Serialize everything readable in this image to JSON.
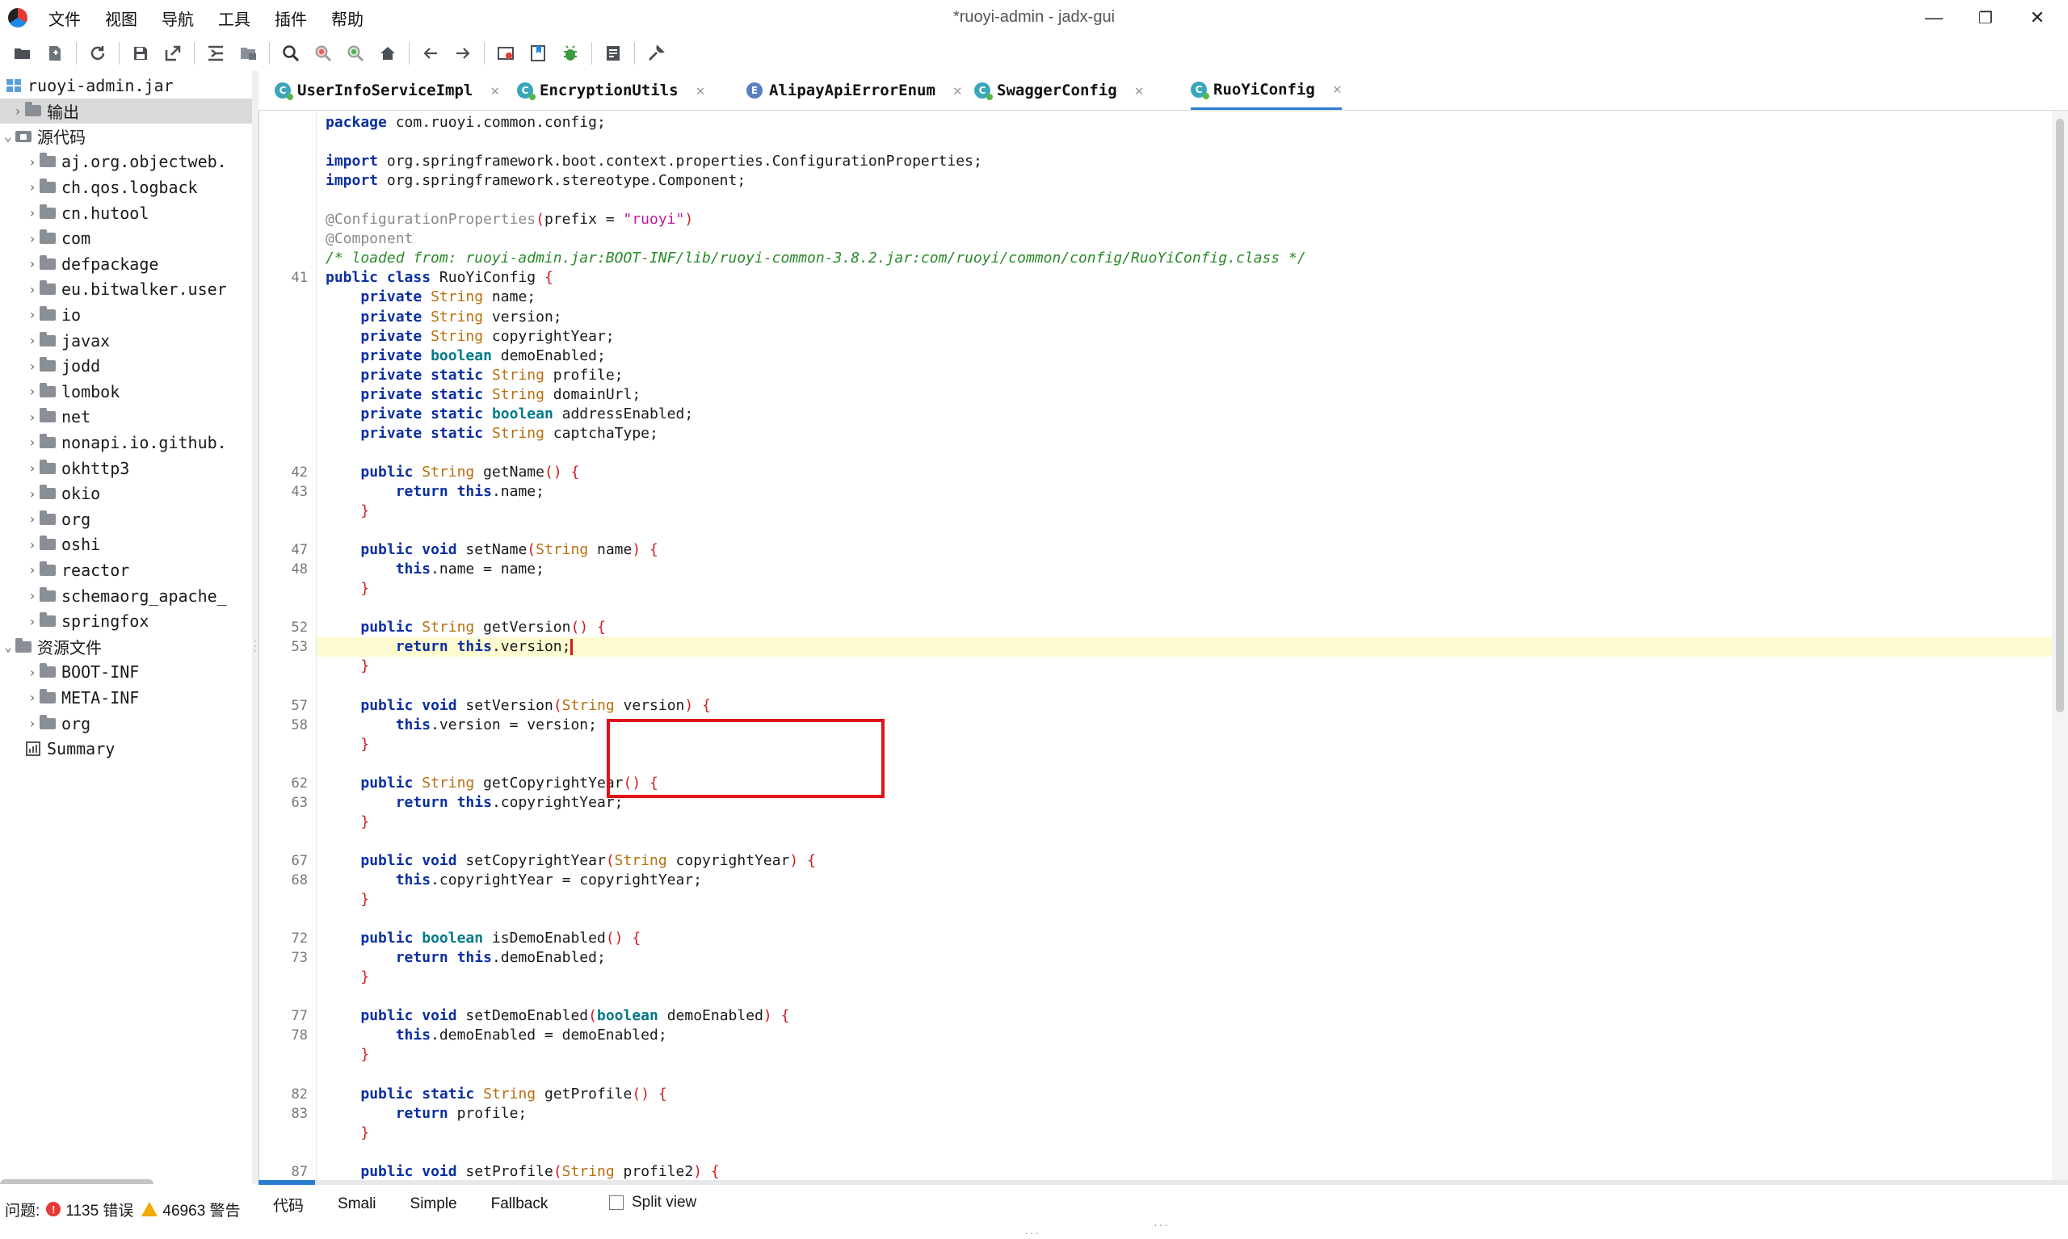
{
  "window": {
    "title": "*ruoyi-admin - jadx-gui",
    "menu": [
      "文件",
      "视图",
      "导航",
      "工具",
      "插件",
      "帮助"
    ],
    "minimize": "—",
    "maximize": "❐",
    "close": "✕"
  },
  "toolbar": {
    "icons": [
      "open-folder-icon",
      "add-files-icon",
      "reload-icon",
      "save-all-icon",
      "export-icon",
      "sync-tree-icon",
      "flatten-packages-icon",
      "search-icon",
      "find-usage-icon",
      "text-search-icon",
      "home-icon",
      "back-icon",
      "forward-icon",
      "quark-icon",
      "bookmark-icon",
      "debug-icon",
      "log-icon",
      "preferences-icon"
    ]
  },
  "tree": {
    "root": "ruoyi-admin.jar",
    "items": [
      {
        "label": "输出",
        "depth": 1,
        "icon": "folder",
        "expanded": false,
        "selected": true
      },
      {
        "label": "源代码",
        "depth": 0,
        "icon": "package",
        "expanded": true,
        "selected": false
      },
      {
        "label": "aj.org.objectweb.",
        "depth": 2,
        "icon": "folder"
      },
      {
        "label": "ch.qos.logback",
        "depth": 2,
        "icon": "folder"
      },
      {
        "label": "cn.hutool",
        "depth": 2,
        "icon": "folder"
      },
      {
        "label": "com",
        "depth": 2,
        "icon": "folder"
      },
      {
        "label": "defpackage",
        "depth": 2,
        "icon": "folder"
      },
      {
        "label": "eu.bitwalker.user",
        "depth": 2,
        "icon": "folder"
      },
      {
        "label": "io",
        "depth": 2,
        "icon": "folder"
      },
      {
        "label": "javax",
        "depth": 2,
        "icon": "folder"
      },
      {
        "label": "jodd",
        "depth": 2,
        "icon": "folder"
      },
      {
        "label": "lombok",
        "depth": 2,
        "icon": "folder"
      },
      {
        "label": "net",
        "depth": 2,
        "icon": "folder"
      },
      {
        "label": "nonapi.io.github.",
        "depth": 2,
        "icon": "folder"
      },
      {
        "label": "okhttp3",
        "depth": 2,
        "icon": "folder"
      },
      {
        "label": "okio",
        "depth": 2,
        "icon": "folder"
      },
      {
        "label": "org",
        "depth": 2,
        "icon": "folder"
      },
      {
        "label": "oshi",
        "depth": 2,
        "icon": "folder"
      },
      {
        "label": "reactor",
        "depth": 2,
        "icon": "folder"
      },
      {
        "label": "schemaorg_apache_",
        "depth": 2,
        "icon": "folder"
      },
      {
        "label": "springfox",
        "depth": 2,
        "icon": "folder"
      },
      {
        "label": "资源文件",
        "depth": 0,
        "icon": "folder",
        "expanded": true
      },
      {
        "label": "BOOT-INF",
        "depth": 2,
        "icon": "folder"
      },
      {
        "label": "META-INF",
        "depth": 2,
        "icon": "folder"
      },
      {
        "label": "org",
        "depth": 2,
        "icon": "folder"
      },
      {
        "label": "Summary",
        "depth": 1,
        "icon": "summary"
      }
    ]
  },
  "tabs": [
    {
      "label": "UserInfoServiceImpl",
      "kind": "class",
      "active": false
    },
    {
      "label": "EncryptionUtils",
      "kind": "class",
      "active": false
    },
    {
      "label": "AlipayApiErrorEnum",
      "kind": "enum",
      "active": false
    },
    {
      "label": "SwaggerConfig",
      "kind": "class",
      "active": false
    },
    {
      "label": "RuoYiConfig",
      "kind": "class",
      "active": true
    }
  ],
  "tab_close": "✕",
  "code": {
    "lines": [
      {
        "ln": "",
        "text": "package com.ruoyi.common.config;"
      },
      {
        "ln": "",
        "text": ""
      },
      {
        "ln": "",
        "text": "import org.springframework.boot.context.properties.ConfigurationProperties;"
      },
      {
        "ln": "",
        "text": "import org.springframework.stereotype.Component;"
      },
      {
        "ln": "",
        "text": ""
      },
      {
        "ln": "",
        "text": "@ConfigurationProperties(prefix = \"ruoyi\")"
      },
      {
        "ln": "",
        "text": "@Component"
      },
      {
        "ln": "",
        "text": "/* loaded from: ruoyi-admin.jar:BOOT-INF/lib/ruoyi-common-3.8.2.jar:com/ruoyi/common/config/RuoYiConfig.class */"
      },
      {
        "ln": "41",
        "text": "public class RuoYiConfig {"
      },
      {
        "ln": "",
        "text": "    private String name;"
      },
      {
        "ln": "",
        "text": "    private String version;"
      },
      {
        "ln": "",
        "text": "    private String copyrightYear;"
      },
      {
        "ln": "",
        "text": "    private boolean demoEnabled;"
      },
      {
        "ln": "",
        "text": "    private static String profile;"
      },
      {
        "ln": "",
        "text": "    private static String domainUrl;"
      },
      {
        "ln": "",
        "text": "    private static boolean addressEnabled;"
      },
      {
        "ln": "",
        "text": "    private static String captchaType;"
      },
      {
        "ln": "",
        "text": ""
      },
      {
        "ln": "42",
        "text": "    public String getName() {"
      },
      {
        "ln": "43",
        "text": "        return this.name;"
      },
      {
        "ln": "",
        "text": "    }"
      },
      {
        "ln": "",
        "text": ""
      },
      {
        "ln": "47",
        "text": "    public void setName(String name) {"
      },
      {
        "ln": "48",
        "text": "        this.name = name;"
      },
      {
        "ln": "",
        "text": "    }"
      },
      {
        "ln": "",
        "text": ""
      },
      {
        "ln": "52",
        "text": "    public String getVersion() {"
      },
      {
        "ln": "53",
        "text": "        return this.version;"
      },
      {
        "ln": "",
        "text": "    }"
      },
      {
        "ln": "",
        "text": ""
      },
      {
        "ln": "57",
        "text": "    public void setVersion(String version) {"
      },
      {
        "ln": "58",
        "text": "        this.version = version;"
      },
      {
        "ln": "",
        "text": "    }"
      },
      {
        "ln": "",
        "text": ""
      },
      {
        "ln": "62",
        "text": "    public String getCopyrightYear() {"
      },
      {
        "ln": "63",
        "text": "        return this.copyrightYear;"
      },
      {
        "ln": "",
        "text": "    }"
      },
      {
        "ln": "",
        "text": ""
      },
      {
        "ln": "67",
        "text": "    public void setCopyrightYear(String copyrightYear) {"
      },
      {
        "ln": "68",
        "text": "        this.copyrightYear = copyrightYear;"
      },
      {
        "ln": "",
        "text": "    }"
      },
      {
        "ln": "",
        "text": ""
      },
      {
        "ln": "72",
        "text": "    public boolean isDemoEnabled() {"
      },
      {
        "ln": "73",
        "text": "        return this.demoEnabled;"
      },
      {
        "ln": "",
        "text": "    }"
      },
      {
        "ln": "",
        "text": ""
      },
      {
        "ln": "77",
        "text": "    public void setDemoEnabled(boolean demoEnabled) {"
      },
      {
        "ln": "78",
        "text": "        this.demoEnabled = demoEnabled;"
      },
      {
        "ln": "",
        "text": "    }"
      },
      {
        "ln": "",
        "text": ""
      },
      {
        "ln": "82",
        "text": "    public static String getProfile() {"
      },
      {
        "ln": "83",
        "text": "        return profile;"
      },
      {
        "ln": "",
        "text": "    }"
      },
      {
        "ln": "",
        "text": ""
      },
      {
        "ln": "87",
        "text": "    public void setProfile(String profile2) {"
      }
    ],
    "highlighted_line_index": 27
  },
  "status": {
    "problems_label": "问题:",
    "errors": "1135 错误",
    "warnings": "46963 警告"
  },
  "code_tabs": [
    "代码",
    "Smali",
    "Simple",
    "Fallback"
  ],
  "split_view": {
    "label": "Split view",
    "checked": false
  },
  "colors": {
    "keyword": "#0b2fa3",
    "type": "#b86f0e",
    "primitive": "#007a8a",
    "string": "#c4189c",
    "comment": "#2a8a2a",
    "brace": "#d11a1a",
    "annotation": "#8a8a8a",
    "highlight": "#fdfcd0",
    "selection_box": "#e0111b",
    "accent": "#2b7cd3"
  }
}
